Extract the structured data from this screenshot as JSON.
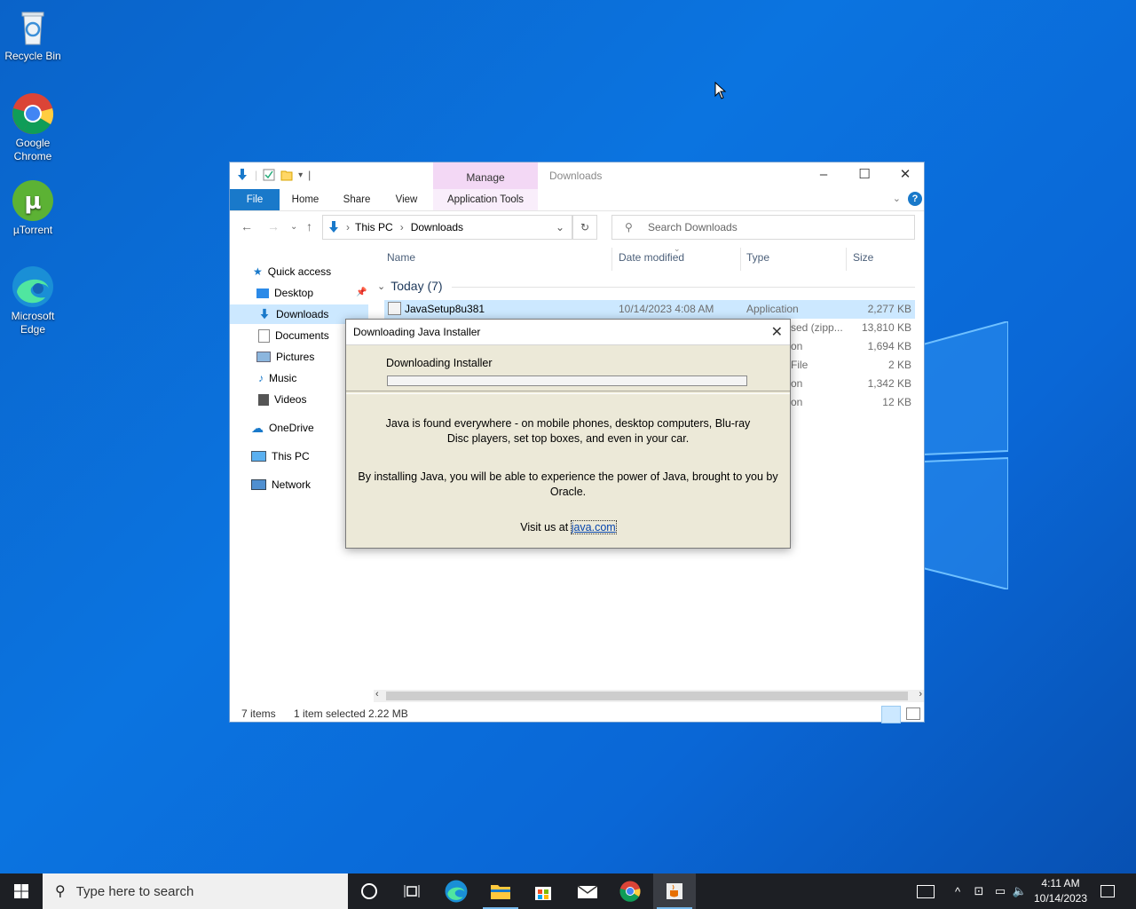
{
  "desktop": {
    "icons": [
      {
        "label": "Recycle Bin"
      },
      {
        "label": "Google Chrome"
      },
      {
        "label": "µTorrent"
      },
      {
        "label": "Microsoft Edge"
      }
    ]
  },
  "explorer": {
    "manage_tab": "Manage",
    "title": "Downloads",
    "ribbon_tabs": {
      "file": "File",
      "home": "Home",
      "share": "Share",
      "view": "View",
      "app_tools": "Application Tools"
    },
    "breadcrumb": {
      "root": "This PC",
      "current": "Downloads"
    },
    "search_placeholder": "Search Downloads",
    "nav": {
      "quick_access": "Quick access",
      "desktop": "Desktop",
      "downloads": "Downloads",
      "documents": "Documents",
      "pictures": "Pictures",
      "music": "Music",
      "videos": "Videos",
      "onedrive": "OneDrive",
      "this_pc": "This PC",
      "network": "Network"
    },
    "columns": {
      "name": "Name",
      "date": "Date modified",
      "type": "Type",
      "size": "Size"
    },
    "group_label": "Today (7)",
    "rows": [
      {
        "name": "JavaSetup8u381",
        "date": "10/14/2023 4:08 AM",
        "type": "Application",
        "size": "2,277 KB"
      },
      {
        "name": "",
        "date": "",
        "type": "sed (zipp...",
        "size": "13,810 KB"
      },
      {
        "name": "",
        "date": "",
        "type": "on",
        "size": "1,694 KB"
      },
      {
        "name": "",
        "date": "",
        "type": "File",
        "size": "2 KB"
      },
      {
        "name": "",
        "date": "",
        "type": "on",
        "size": "1,342 KB"
      },
      {
        "name": "",
        "date": "",
        "type": "on",
        "size": "12 KB"
      }
    ],
    "status": {
      "items": "7 items",
      "selected": "1 item selected  2.22 MB"
    }
  },
  "java_dialog": {
    "title": "Downloading Java Installer",
    "heading": "Downloading Installer",
    "progress": 0.0,
    "para1": "Java is found everywhere - on mobile phones, desktop computers, Blu-ray Disc players, set top boxes, and even in your car.",
    "para2": "By installing Java, you will be able to experience the power of Java, brought to you by Oracle.",
    "visit_prefix": "Visit us at ",
    "visit_link": "java.com"
  },
  "taskbar": {
    "search_placeholder": "Type here to search",
    "clock_time": "4:11 AM",
    "clock_date": "10/14/2023"
  },
  "colors": {
    "accent": "#1979ca",
    "selection": "#cce8ff",
    "dialog_bg": "#ece9d8",
    "taskbar": "#1d1f24"
  }
}
